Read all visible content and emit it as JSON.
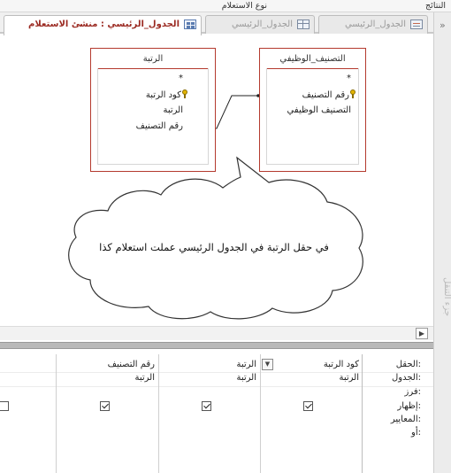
{
  "ribbon": {
    "results_label": "النتائج",
    "query_type_label": "نوع الاستعلام"
  },
  "tabs": [
    {
      "label": "الجدول_الرئيسي",
      "icon": "form-icon",
      "active": false
    },
    {
      "label": "الجدول_الرئيسي",
      "icon": "table-icon",
      "active": false
    },
    {
      "label": "الجدول_الرئيسي : منشئ الاستعلام",
      "icon": "query-design-icon",
      "active": true
    }
  ],
  "nav_pane": {
    "label": "جزء التنقل",
    "chevron": "»"
  },
  "tables": {
    "right": {
      "title": "التصنيف_الوظيفي",
      "star": "*",
      "fields": [
        "رقم التصنيف",
        "التصنيف الوظيفي"
      ],
      "key_field": "رقم التصنيف"
    },
    "left": {
      "title": "الرتبة",
      "star": "*",
      "fields": [
        "كود الرتبة",
        "الرتبة",
        "رقم التصنيف"
      ],
      "key_field": "كود الرتبة"
    }
  },
  "callout": {
    "text": "في حقل الرتبة في الجدول الرئيسي عملت استعلام كذا"
  },
  "grid": {
    "row_labels": [
      "الحقل:",
      "الجدول:",
      "فرز:",
      "إظهار:",
      "المعايير:",
      "أو:"
    ],
    "columns": [
      {
        "field": "كود الرتبة",
        "table": "الرتبة",
        "show": true
      },
      {
        "field": "الرتبة",
        "table": "الرتبة",
        "show": true
      },
      {
        "field": "رقم التصنيف",
        "table": "الرتبة",
        "show": true
      },
      {
        "field": "",
        "table": "",
        "show": false
      }
    ]
  },
  "colors": {
    "accent": "#9b2a22",
    "table_border": "#b43a2e",
    "splitter": "#b9b9b9"
  }
}
